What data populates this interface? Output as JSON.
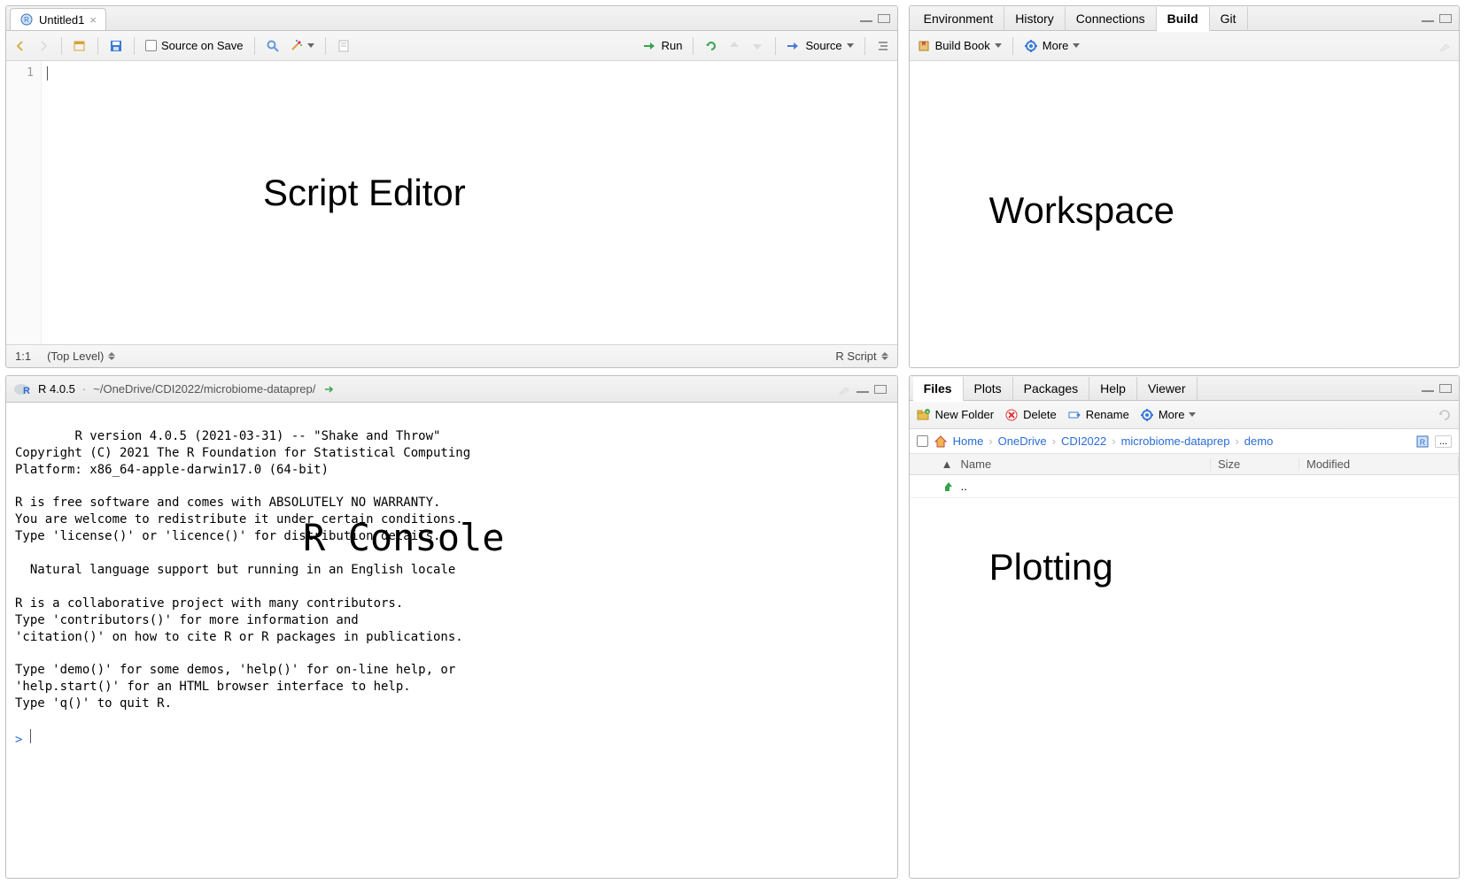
{
  "editor": {
    "tab_title": "Untitled1",
    "source_on_save": "Source on Save",
    "run": "Run",
    "source": "Source",
    "line_number": "1",
    "overlay": "Script Editor",
    "status_pos": "1:1",
    "status_scope": "(Top Level)",
    "status_type": "R Script"
  },
  "console": {
    "r_version_label": "R 4.0.5",
    "path": "~/OneDrive/CDI2022/microbiome-dataprep/",
    "overlay": "R Console",
    "text": "R version 4.0.5 (2021-03-31) -- \"Shake and Throw\"\nCopyright (C) 2021 The R Foundation for Statistical Computing\nPlatform: x86_64-apple-darwin17.0 (64-bit)\n\nR is free software and comes with ABSOLUTELY NO WARRANTY.\nYou are welcome to redistribute it under certain conditions.\nType 'license()' or 'licence()' for distribution details.\n\n  Natural language support but running in an English locale\n\nR is a collaborative project with many contributors.\nType 'contributors()' for more information and\n'citation()' on how to cite R or R packages in publications.\n\nType 'demo()' for some demos, 'help()' for on-line help, or\n'help.start()' for an HTML browser interface to help.\nType 'q()' to quit R.\n",
    "prompt": ">"
  },
  "env": {
    "tabs": [
      "Environment",
      "History",
      "Connections",
      "Build",
      "Git"
    ],
    "active_tab_index": 3,
    "build_book": "Build Book",
    "more": "More",
    "overlay": "Workspace"
  },
  "files": {
    "tabs": [
      "Files",
      "Plots",
      "Packages",
      "Help",
      "Viewer"
    ],
    "active_tab_index": 0,
    "new_folder": "New Folder",
    "delete": "Delete",
    "rename": "Rename",
    "more": "More",
    "breadcrumb": [
      "Home",
      "OneDrive",
      "CDI2022",
      "microbiome-dataprep",
      "demo"
    ],
    "head_name": "Name",
    "head_size": "Size",
    "head_modified": "Modified",
    "up_label": "..",
    "ellipsis": "...",
    "overlay": "Plotting"
  },
  "colors": {
    "link": "#2a6bd6"
  }
}
